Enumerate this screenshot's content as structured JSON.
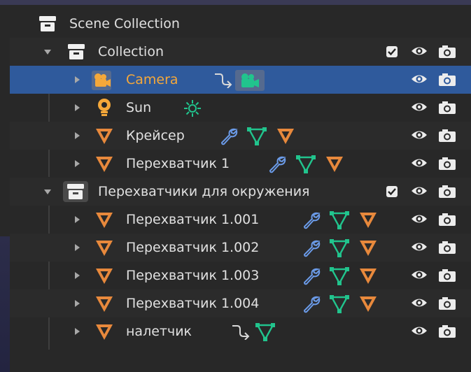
{
  "outliner": {
    "scene": {
      "label": "Scene Collection"
    },
    "rows": [
      {
        "label": "Collection",
        "type": "collection",
        "expanded": true
      },
      {
        "label": "Camera",
        "type": "camera",
        "selected": true
      },
      {
        "label": "Sun",
        "type": "light"
      },
      {
        "label": "Крейсер",
        "type": "mesh"
      },
      {
        "label": "Перехватчик 1",
        "type": "mesh"
      },
      {
        "label": "Перехватчики для окружения",
        "type": "collection",
        "expanded": true
      },
      {
        "label": "Перехватчик 1.001",
        "type": "mesh"
      },
      {
        "label": "Перехватчик 1.002",
        "type": "mesh"
      },
      {
        "label": "Перехватчик 1.003",
        "type": "mesh"
      },
      {
        "label": "Перехватчик 1.004",
        "type": "mesh"
      },
      {
        "label": "налетчик",
        "type": "mesh"
      }
    ]
  },
  "colors": {
    "background": "#282828",
    "selected_row": "#2f5a9c",
    "active_text": "#f5a83a",
    "mesh_icon": "#e8893c",
    "mesh_data_icon": "#21c48d",
    "modifier_icon": "#6b9be8",
    "light_icon": "#f5a83a",
    "text": "#e0e0e0"
  },
  "icons": {
    "scene_collection": "collection-box-icon",
    "collection": "collection-box-icon",
    "camera": "camera-object-icon",
    "light": "light-bulb-icon",
    "mesh": "mesh-triangle-icon",
    "modifier": "wrench-icon",
    "mesh_data": "mesh-data-icon",
    "parent_relation": "curved-arrow-icon",
    "visibility": "eye-icon",
    "render": "camera-render-icon",
    "exclude": "checkbox-icon"
  }
}
